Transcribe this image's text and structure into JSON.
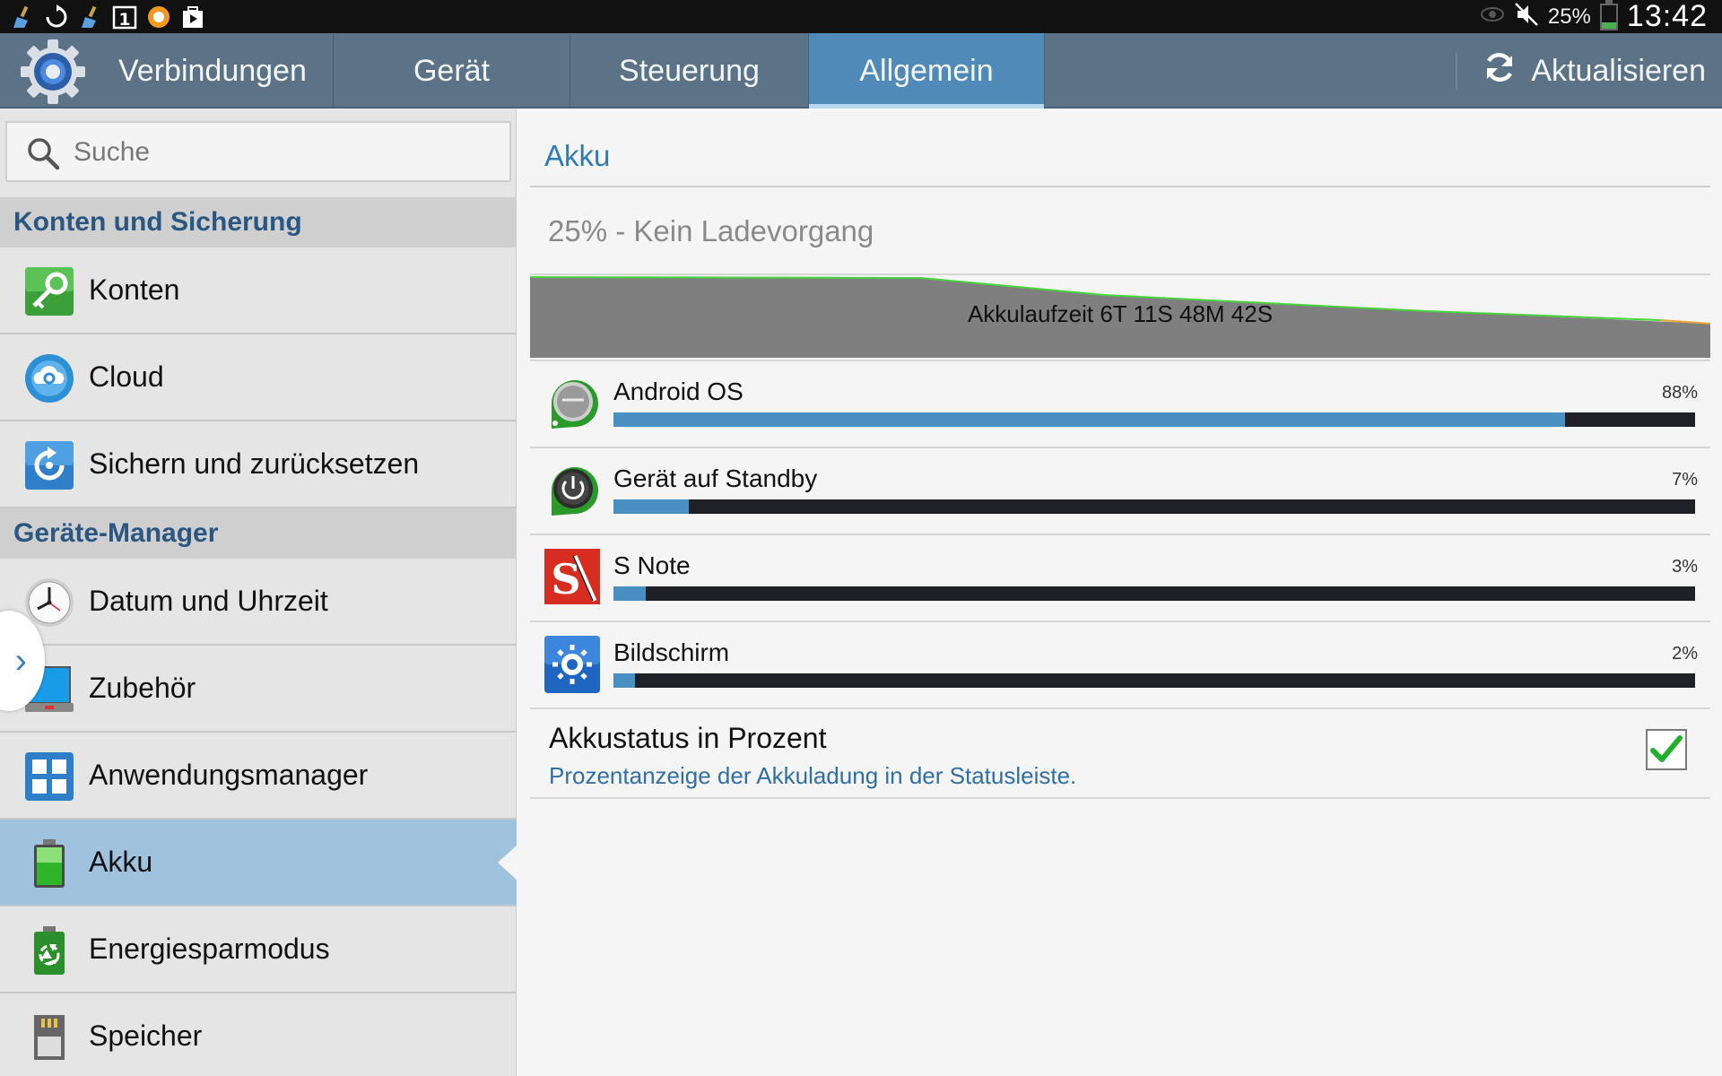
{
  "status_bar": {
    "battery_percent_text": "25%",
    "time": "13:42",
    "notification_icons": [
      "broom-icon",
      "sync-icon",
      "broom-icon",
      "calendar-1-icon",
      "orange-circle-icon",
      "play-store-icon"
    ],
    "calendar_day": "1",
    "battery_level": 0.25
  },
  "header": {
    "tabs": [
      {
        "label": "Verbindungen",
        "active": false
      },
      {
        "label": "Gerät",
        "active": false
      },
      {
        "label": "Steuerung",
        "active": false
      },
      {
        "label": "Allgemein",
        "active": true
      }
    ],
    "refresh_label": "Aktualisieren"
  },
  "sidebar": {
    "search_placeholder": "Suche",
    "sections": [
      {
        "title": "Konten und Sicherung",
        "items": [
          {
            "label": "Konten",
            "icon": "key-icon"
          },
          {
            "label": "Cloud",
            "icon": "cloud-icon"
          },
          {
            "label": "Sichern und zurücksetzen",
            "icon": "backup-restore-icon"
          }
        ]
      },
      {
        "title": "Geräte-Manager",
        "items": [
          {
            "label": "Datum und Uhrzeit",
            "icon": "clock-icon"
          },
          {
            "label": "Zubehör",
            "icon": "accessory-icon"
          },
          {
            "label": "Anwendungsmanager",
            "icon": "app-manager-icon"
          },
          {
            "label": "Akku",
            "icon": "battery-icon",
            "selected": true
          },
          {
            "label": "Energiesparmodus",
            "icon": "power-saving-icon"
          },
          {
            "label": "Speicher",
            "icon": "storage-icon"
          }
        ]
      }
    ]
  },
  "main": {
    "title": "Akku",
    "status": "25% - Kein Ladevorgang",
    "graph_label": "Akkulaufzeit 6T 11S 48M 42S",
    "usage": [
      {
        "name": "Android OS",
        "percent_text": "88%",
        "value": 88,
        "icon": "android-os-icon"
      },
      {
        "name": "Gerät auf Standby",
        "percent_text": "7%",
        "value": 7,
        "icon": "standby-icon"
      },
      {
        "name": "S Note",
        "percent_text": "3%",
        "value": 3,
        "icon": "s-note-icon"
      },
      {
        "name": "Bildschirm",
        "percent_text": "2%",
        "value": 2,
        "icon": "screen-brightness-icon"
      }
    ],
    "pref": {
      "title": "Akkustatus in Prozent",
      "subtitle": "Prozentanzeige der Akkuladung in der Statusleiste.",
      "checked": true
    }
  },
  "colors": {
    "action_bar": "#5c7387",
    "active_tab": "#4f8ab8",
    "selected_item": "#9fc2df",
    "section_text": "#2a5782",
    "accent": "#2f7bb5",
    "usage_bar": "#4a8fc2",
    "graph_line": "#46d53a"
  }
}
